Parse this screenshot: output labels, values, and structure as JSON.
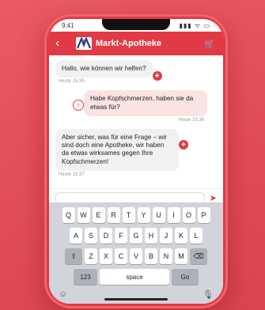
{
  "statusbar": {
    "time": "9:41",
    "icons": "▮▮▮ ᯤ ▭"
  },
  "header": {
    "back_icon": "‹",
    "logo_text": "Markt-Apotheke",
    "cart_icon": "🛒"
  },
  "messages": [
    {
      "from": "agent",
      "text": "Hallo, wie können wir helfen?",
      "time": "Heute 15:35"
    },
    {
      "from": "user",
      "text": "Habe Kopfschmerzen, haben sie da etwas für?",
      "time": "Heute 15:36"
    },
    {
      "from": "agent",
      "text": "Aber sicher, was für eine Frage – wir sind doch eine Apotheke, wir haben da etwas wirksames gegen Ihre Kopfschmerzen!",
      "time": "Heute 15:37"
    }
  ],
  "input": {
    "placeholder": "",
    "send_icon": "➤"
  },
  "keyboard": {
    "row1": [
      "Q",
      "W",
      "E",
      "R",
      "T",
      "Y",
      "U",
      "I",
      "O",
      "P"
    ],
    "row2": [
      "A",
      "S",
      "D",
      "F",
      "G",
      "H",
      "J",
      "K",
      "L"
    ],
    "row3": [
      "Z",
      "X",
      "C",
      "V",
      "B",
      "N",
      "M"
    ],
    "shift": "⇧",
    "backspace": "⌫",
    "numbers": "123",
    "space": "space",
    "go": "Go",
    "emoji_icon": "☺",
    "mic_icon": "🎙"
  },
  "colors": {
    "accent": "#e23a45",
    "background": "#e04b56"
  }
}
